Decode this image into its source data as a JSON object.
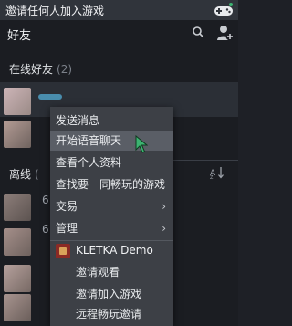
{
  "topbar": {
    "title": "邀请任何人加入游戏",
    "icon": "gamepad-icon"
  },
  "friends_header": {
    "label": "好友",
    "search_icon": "search-icon",
    "add_icon": "add-friend-icon"
  },
  "groups": {
    "online": {
      "label": "在线好友",
      "count": "(2)"
    },
    "offline": {
      "label": "离线",
      "count": "("
    }
  },
  "offline_rows": [
    "6",
    "6"
  ],
  "context_menu": {
    "items": [
      {
        "label": "发送消息"
      },
      {
        "label": "开始语音聊天"
      },
      {
        "label": "查看个人资料"
      },
      {
        "label": "查找要一同畅玩的游戏"
      },
      {
        "label": "交易",
        "arrow": "›"
      },
      {
        "label": "管理",
        "arrow": "›"
      }
    ],
    "game": {
      "name": "KLETKA Demo",
      "items": [
        {
          "label": "邀请观看"
        },
        {
          "label": "邀请加入游戏"
        },
        {
          "label": "远程畅玩邀请"
        }
      ]
    }
  },
  "colors": {
    "menu_bg": "#3d4046",
    "highlight": "#5a5e66",
    "accent_green": "#3cb371"
  }
}
